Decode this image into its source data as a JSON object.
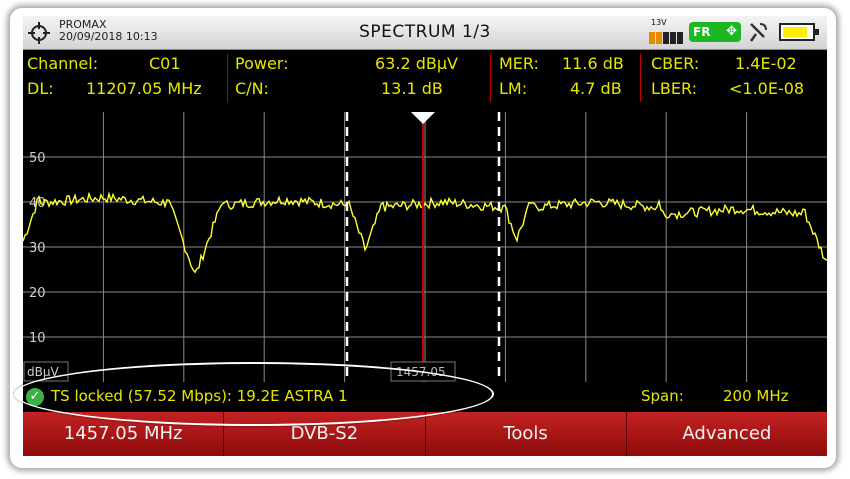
{
  "header": {
    "brand": "PROMAX",
    "datetime": "20/09/2018 10:13",
    "title": "SPECTRUM 1/3",
    "voltage": "13V",
    "fr_badge": "FR",
    "icons": [
      "crosshair-icon",
      "move-arrows-icon",
      "antenna-icon",
      "battery-icon"
    ]
  },
  "measurements": {
    "channel_label": "Channel:",
    "channel_value": "C01",
    "dl_label": "DL:",
    "dl_value": "11207.05 MHz",
    "power_label": "Power:",
    "power_value": "63.2 dBµV",
    "cn_label": "C/N:",
    "cn_value": "13.1 dB",
    "mer_label": "MER:",
    "mer_value": "11.6 dB",
    "lm_label": "LM:",
    "lm_value": "4.7 dB",
    "cber_label": "CBER:",
    "cber_value": "1.4E-02",
    "lber_label": "LBER:",
    "lber_value": "<1.0E-08"
  },
  "plot": {
    "y_unit": "dBµV",
    "marker_freq": "1457.05",
    "y_ticks": [
      "50",
      "40",
      "30",
      "20",
      "10"
    ]
  },
  "status": {
    "ts_text": "TS locked (57.52 Mbps): 19.2E ASTRA 1",
    "span_label": "Span:",
    "span_value": "200 MHz"
  },
  "softkeys": {
    "freq": "1457.05 MHz",
    "standard": "DVB-S2",
    "tools": "Tools",
    "advanced": "Advanced"
  },
  "colors": {
    "trace": "#ffff33",
    "measure_text": "#e6e600",
    "softkey_red": "#b01818",
    "marker_red": "#d00000"
  }
}
